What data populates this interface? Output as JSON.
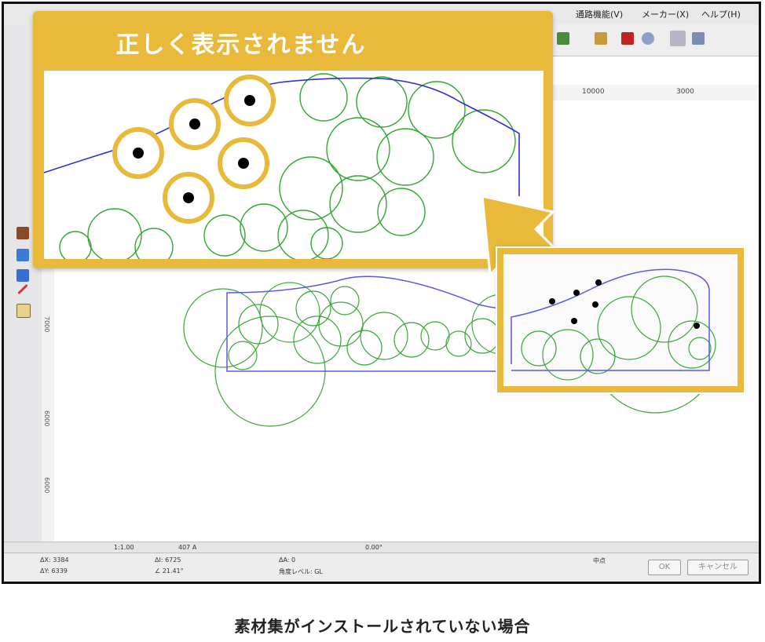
{
  "menubar": {
    "items": [
      "通路機能(V)",
      "メーカー(X)",
      "ヘルプ(H)"
    ]
  },
  "ruler": {
    "top_labels": [
      "10000",
      "3000"
    ],
    "left_labels": [
      "7000",
      "6000",
      "6000"
    ]
  },
  "bottom_bar": {
    "scale_value": "1:1.00",
    "layer_value": "407 A",
    "angle_value": "0.00°"
  },
  "status_bar": {
    "coord_x": "ΔX: 3384",
    "coord_y": "ΔY: 6339",
    "dist": "ΔI: 6725",
    "angle": "∠ 21.41°",
    "delta": "ΔA: 0",
    "mode": "角度レベル: GL",
    "mid_label": "中点",
    "ok_label": "OK",
    "cancel_label": "キャンセル"
  },
  "callout": {
    "title": "正しく表示されません"
  },
  "caption": {
    "text": "素材集がインストールされていない場合"
  },
  "colors": {
    "accent": "#e8b93a",
    "tree_green": "#2fa82f",
    "line_blue": "#2222cc",
    "dot_black": "#000000"
  },
  "icons": [
    "arrow-up-left-icon",
    "ok-button",
    "cancel-button"
  ]
}
